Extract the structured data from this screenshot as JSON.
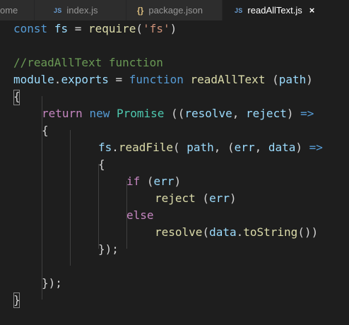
{
  "tabs": [
    {
      "label": "ome",
      "icon": "",
      "active": false
    },
    {
      "label": "index.js",
      "icon": "JS",
      "active": false
    },
    {
      "label": "package.json",
      "icon": "{}",
      "active": false
    },
    {
      "label": "readAllText.js",
      "icon": "JS",
      "active": true,
      "close": "×"
    }
  ],
  "code": {
    "line1": {
      "kw": "const",
      "var": "fs",
      "eq": " = ",
      "fn": "require",
      "open": "(",
      "str": "'fs'",
      "close": ")"
    },
    "line3": {
      "comment": "//readAllText function"
    },
    "line4": {
      "module": "module",
      "dot": ".",
      "exports": "exports",
      "eq": " = ",
      "kw": "function",
      "name": "readAllText",
      "open": " (",
      "param": "path",
      "close": ")"
    },
    "line5": {
      "brace": "{"
    },
    "line6": {
      "ret": "return",
      "new": "new",
      "cls": "Promise",
      "open": " ((",
      "p1": "resolve",
      "comma": ", ",
      "p2": "reject",
      "close": ") ",
      "arrow": "=>"
    },
    "line7": {
      "brace": "{"
    },
    "line8": {
      "obj": "fs",
      "dot": ".",
      "fn": "readFile",
      "open": "( ",
      "p1": "path",
      "mid": ", (",
      "p2": "err",
      "comma": ", ",
      "p3": "data",
      "close": ") ",
      "arrow": "=>"
    },
    "line9": {
      "brace": "{"
    },
    "line10": {
      "kw": "if",
      "open": " (",
      "var": "err",
      "close": ")"
    },
    "line11": {
      "fn": "reject",
      "open": " (",
      "var": "err",
      "close": ")"
    },
    "line12": {
      "kw": "else"
    },
    "line13": {
      "fn": "resolve",
      "open": "(",
      "var": "data",
      "dot": ".",
      "fn2": "toString",
      "close": "())"
    },
    "line14": {
      "text": "});"
    },
    "line16": {
      "text": "});"
    },
    "line17": {
      "brace": "}"
    }
  }
}
